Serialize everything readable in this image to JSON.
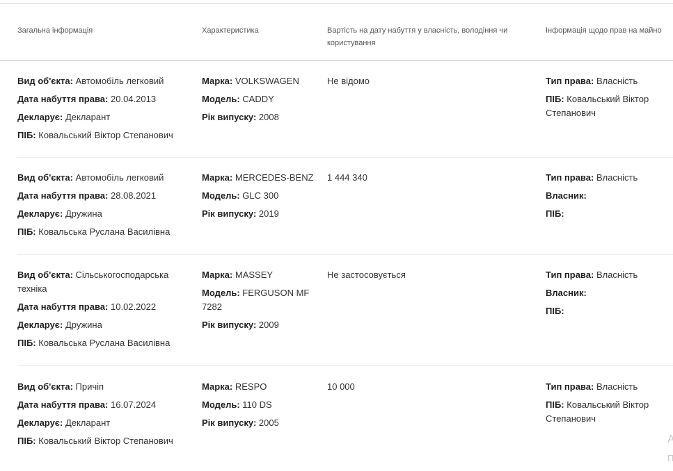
{
  "table": {
    "headers": {
      "general": "Загальна інформація",
      "characteristics": "Характеристика",
      "value": "Вартість на дату набуття у власність, володіння чи користування",
      "rights": "Інформація щодо прав на майно"
    },
    "labels": {
      "object_type": "Вид об'єкта:",
      "acquisition_date": "Дата набуття права:",
      "declarant": "Декларує:",
      "full_name": "ПІБ:",
      "brand": "Марка:",
      "model": "Модель:",
      "year": "Рік випуску:",
      "right_type": "Тип права:",
      "owner": "Власник:"
    },
    "rows": [
      {
        "object_type": "Автомобіль легковий",
        "acquisition_date": "20.04.2013",
        "declarant": "Декларант",
        "full_name": "Ковальський Віктор Степанович",
        "brand": "VOLKSWAGEN",
        "model": "CADDY",
        "year": "2008",
        "value": "Не відомо",
        "right_type": "Власність",
        "rights_full_name": "Ковальський Віктор Степанович"
      },
      {
        "object_type": "Автомобіль легковий",
        "acquisition_date": "28.08.2021",
        "declarant": "Дружина",
        "full_name": "Ковальська Руслана Василівна",
        "brand": "MERCEDES-BENZ",
        "model": "GLC 300",
        "year": "2019",
        "value": "1 444 340",
        "right_type": "Власність",
        "owner": "",
        "rights_full_name": ""
      },
      {
        "object_type": "Сільськогосподарська техніка",
        "acquisition_date": "10.02.2022",
        "declarant": "Дружина",
        "full_name": "Ковальська Руслана Василівна",
        "brand": "MASSEY",
        "model": "FERGUSON MF 7282",
        "year": "2009",
        "value": "Не застосовується",
        "right_type": "Власність",
        "owner": "",
        "rights_full_name": ""
      },
      {
        "object_type": "Причіп",
        "acquisition_date": "16.07.2024",
        "declarant": "Декларант",
        "full_name": "Ковальський Віктор Степанович",
        "brand": "RESPO",
        "model": "110 DS",
        "year": "2005",
        "value": "10 000",
        "right_type": "Власність",
        "rights_full_name": "Ковальський Віктор Степанович"
      }
    ]
  },
  "watermark": {
    "line1": "А",
    "line2": "П"
  }
}
